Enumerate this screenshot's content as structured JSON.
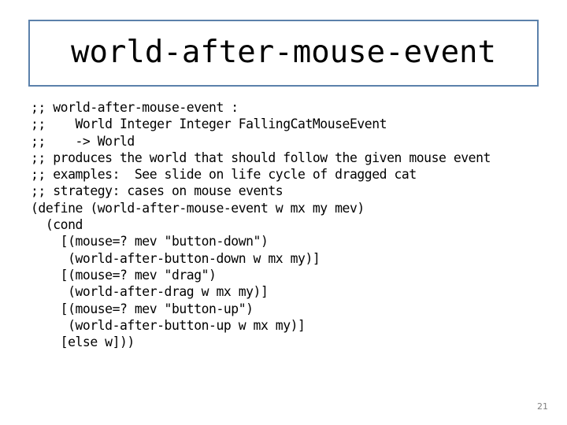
{
  "slide": {
    "title": "world-after-mouse-event",
    "page_number": "21",
    "accent_color": "#5b81ab",
    "background_color": "#ffffff",
    "text_color": "#000000",
    "page_number_color": "#808080",
    "code_lines": [
      ";; world-after-mouse-event :",
      ";;    World Integer Integer FallingCatMouseEvent",
      ";;    -> World",
      ";; produces the world that should follow the given mouse event",
      ";; examples:  See slide on life cycle of dragged cat",
      ";; strategy: cases on mouse events",
      "(define (world-after-mouse-event w mx my mev)",
      "  (cond",
      "    [(mouse=? mev \"button-down\")",
      "     (world-after-button-down w mx my)]",
      "    [(mouse=? mev \"drag\")",
      "     (world-after-drag w mx my)]",
      "    [(mouse=? mev \"button-up\")",
      "     (world-after-button-up w mx my)]",
      "    [else w]))"
    ]
  }
}
